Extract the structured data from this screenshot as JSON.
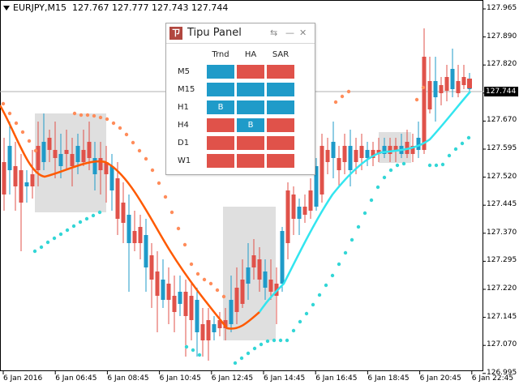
{
  "chart": {
    "symbol": "EURJPY,M15",
    "ohlc": "127.767 127.777 127.743 127.744",
    "current_price": "127.744",
    "price_labels": [
      "127.965",
      "127.890",
      "127.820",
      "127.745",
      "127.670",
      "127.595",
      "127.520",
      "127.445",
      "127.370",
      "127.295",
      "127.220",
      "127.145",
      "127.070",
      "126.995"
    ],
    "time_labels": [
      "6 Jan 2016",
      "6 Jan 06:45",
      "6 Jan 08:45",
      "6 Jan 10:45",
      "6 Jan 12:45",
      "6 Jan 14:45",
      "6 Jan 16:45",
      "6 Jan 18:45",
      "6 Jan 20:45",
      "6 Jan 22:45"
    ],
    "colors": {
      "bull": "#1f9bc9",
      "bear": "#e0524a",
      "ma_down": "#ff5a00",
      "ma_up": "#33e5ef",
      "sar_up": "#33d6d6",
      "sar_down": "#ff8c5a",
      "box": "#d9d9d9"
    }
  },
  "panel": {
    "title": "Tipu Panel",
    "logo_glyph": "ㄗ",
    "columns": [
      "Trnd",
      "HA",
      "SAR"
    ],
    "rows": [
      {
        "label": "M5",
        "cells": [
          {
            "color": "blue",
            "text": ""
          },
          {
            "color": "red",
            "text": ""
          },
          {
            "color": "red",
            "text": ""
          }
        ]
      },
      {
        "label": "M15",
        "cells": [
          {
            "color": "blue",
            "text": ""
          },
          {
            "color": "blue",
            "text": ""
          },
          {
            "color": "blue",
            "text": ""
          }
        ]
      },
      {
        "label": "H1",
        "cells": [
          {
            "color": "blue",
            "text": "B"
          },
          {
            "color": "blue",
            "text": ""
          },
          {
            "color": "blue",
            "text": ""
          }
        ]
      },
      {
        "label": "H4",
        "cells": [
          {
            "color": "red",
            "text": ""
          },
          {
            "color": "blue",
            "text": "B"
          },
          {
            "color": "red",
            "text": ""
          }
        ]
      },
      {
        "label": "D1",
        "cells": [
          {
            "color": "red",
            "text": ""
          },
          {
            "color": "red",
            "text": ""
          },
          {
            "color": "red",
            "text": ""
          }
        ]
      },
      {
        "label": "W1",
        "cells": [
          {
            "color": "red",
            "text": ""
          },
          {
            "color": "red",
            "text": ""
          },
          {
            "color": "red",
            "text": ""
          }
        ]
      }
    ]
  }
}
